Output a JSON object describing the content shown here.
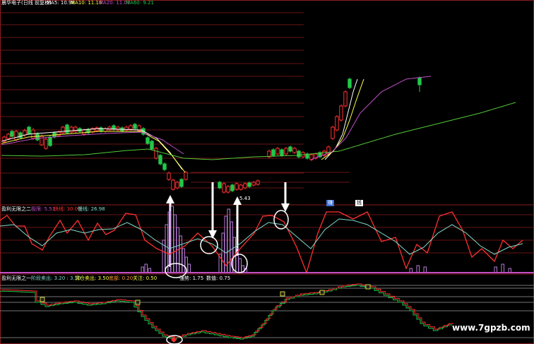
{
  "colors": {
    "bg": "#000000",
    "grid": "#8b1c1c",
    "red": "#ff3030",
    "green": "#22c84a",
    "white": "#ffffff",
    "yellow": "#ffff44",
    "magenta": "#c050c8",
    "cyan": "#7fd9c9",
    "lime": "#54c83a",
    "purple": "#b57bd6"
  },
  "header": {
    "stock": "晨华电子(日线 前复权)",
    "ma5": "MA5: 10.98",
    "ma10": "MA10: 11.16",
    "ma20": "MA20: 11.07",
    "ma60": "MA60: 9.21"
  },
  "panel2": {
    "title": "盈利无限之二",
    "b1": "极限: 5.51",
    "b2": "快线: 30.00",
    "b3": "慢线: 26.98",
    "tag1": "赚",
    "tag2": "钱"
  },
  "panel3": {
    "title": "盈利无限之一",
    "b1": "阶段卖出: 3.20 : 3.50",
    "b2": "清仓卖出: 3.50",
    "b3": "底部: 0.20",
    "b4": "关注: 0.50",
    "b5": "强势: 1.75",
    "b6": "数值: 0.75"
  },
  "price_annotation": "5.43",
  "watermark": "www.7gpzb.com",
  "chart_data": [
    {
      "type": "candlestick",
      "series": [
        {
          "name": "MA5",
          "values": [
            10.98
          ]
        },
        {
          "name": "MA10",
          "values": [
            11.16
          ]
        },
        {
          "name": "MA20",
          "values": [
            11.07
          ]
        },
        {
          "name": "MA60",
          "values": [
            9.21
          ]
        }
      ],
      "annotations": [
        "5.43"
      ]
    },
    {
      "type": "line",
      "series": [
        {
          "name": "极限",
          "values": [
            5.51
          ]
        },
        {
          "name": "快线",
          "values": [
            30.0
          ]
        },
        {
          "name": "慢线",
          "values": [
            26.98
          ]
        }
      ]
    },
    {
      "type": "line",
      "series": [
        {
          "name": "阶段卖出",
          "values": [
            3.2,
            3.5
          ]
        },
        {
          "name": "清仓卖出",
          "values": [
            3.5
          ]
        },
        {
          "name": "底部",
          "values": [
            0.2
          ]
        },
        {
          "name": "关注",
          "values": [
            0.5
          ]
        },
        {
          "name": "强势",
          "values": [
            1.75
          ]
        },
        {
          "name": "数值",
          "values": [
            0.75
          ]
        }
      ]
    }
  ]
}
